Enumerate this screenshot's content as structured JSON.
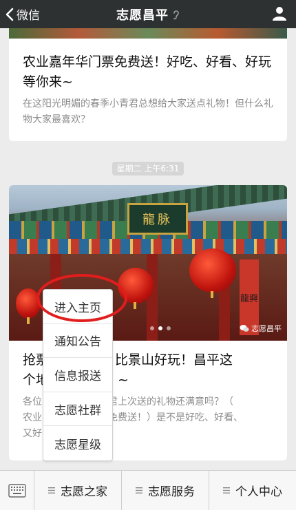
{
  "header": {
    "back_label": "微信",
    "title": "志愿昌平",
    "back_icon": "chevron-left-icon",
    "user_icon": "user-icon"
  },
  "article1": {
    "headline": "农业嘉年华门票免费送！好吃、好看、好玩等你来~",
    "summary": "在这阳光明媚的春季小青君总想给大家送点礼物！但什么礼物大家最喜欢？"
  },
  "timestamp": "星期二 上午6:31",
  "article2": {
    "plaque_text": "龍脉",
    "couplet_text": "龍興",
    "watermark": "志愿昌平",
    "headline_parts": [
      "抢票",
      "绝！比景山好玩！昌平这",
      "个地",
      "~"
    ],
    "summary_parts": [
      "各位",
      "君上次送的礼物还满意吗？（",
      "农业",
      "免费送！）是不是好吃、好看、",
      "又好"
    ]
  },
  "popup_menu": {
    "items": [
      "进入主页",
      "通知公告",
      "信息报送",
      "志愿社群",
      "志愿星级"
    ],
    "highlight_color": "#e11d1d"
  },
  "bottom_nav": {
    "keyboard_icon": "keyboard-icon",
    "tabs": [
      "志愿之家",
      "志愿服务",
      "个人中心"
    ]
  }
}
